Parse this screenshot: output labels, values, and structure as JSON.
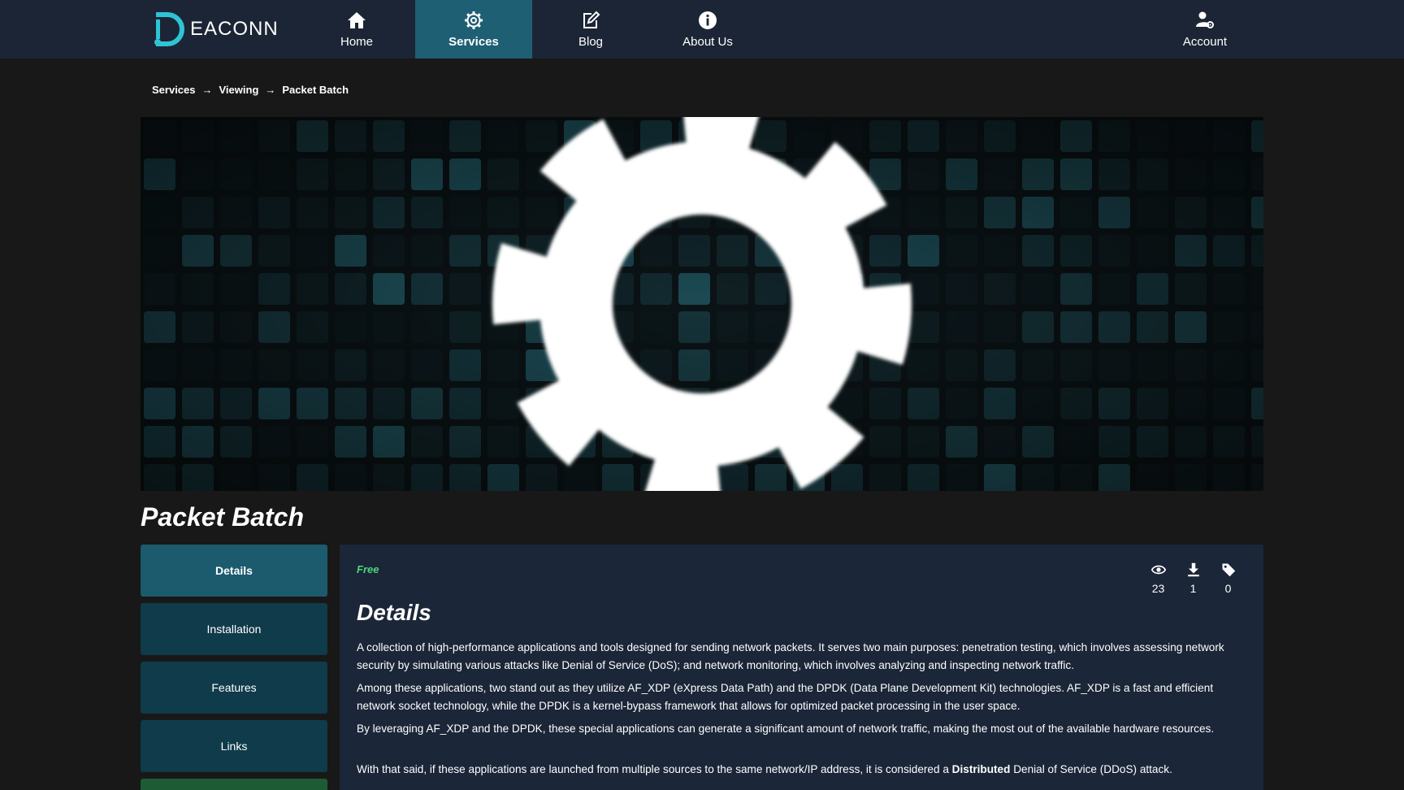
{
  "nav": {
    "logo_text": "EACONN",
    "items": [
      {
        "label": "Home",
        "icon": "home-icon"
      },
      {
        "label": "Services",
        "icon": "gear-icon"
      },
      {
        "label": "Blog",
        "icon": "edit-icon"
      },
      {
        "label": "About Us",
        "icon": "info-icon"
      },
      {
        "label": "Account",
        "icon": "user-gear-icon"
      }
    ],
    "active": "Services"
  },
  "breadcrumb": [
    "Services",
    "Viewing",
    "Packet Batch"
  ],
  "breadcrumb_separator": "→",
  "title": "Packet Batch",
  "sidebar": [
    "Details",
    "Installation",
    "Features",
    "Links"
  ],
  "panel": {
    "price": "Free",
    "stats": [
      {
        "icon": "eye-icon",
        "value": "23"
      },
      {
        "icon": "download-icon",
        "value": "1"
      },
      {
        "icon": "tag-icon",
        "value": "0"
      }
    ],
    "heading": "Details",
    "paragraphs": [
      "A collection of high-performance applications and tools designed for sending network packets. It serves two main purposes: penetration testing, which involves assessing network security by simulating various attacks like Denial of Service (DoS); and network monitoring, which involves analyzing and inspecting network traffic.",
      "Among these applications, two stand out as they utilize AF_XDP (eXpress Data Path) and the DPDK (Data Plane Development Kit) technologies. AF_XDP is a fast and efficient network socket technology, while the DPDK is a kernel-bypass framework that allows for optimized packet processing in the user space.",
      "By leveraging AF_XDP and the DPDK, these special applications can generate a significant amount of network traffic, making the most out of the available hardware resources."
    ],
    "para4": {
      "before": "With that said, if these applications are launched from multiple sources to the same network/IP address, it is considered a ",
      "bold": "Distributed",
      "after": " Denial of Service (DDoS) attack."
    }
  },
  "colors": {
    "nav_bg": "#1c2535",
    "nav_active": "#1f5f73",
    "page_bg": "#181818",
    "panel_bg": "#1b2638",
    "side_btn": "#0f3b4a",
    "side_btn_active": "#1c5a6d",
    "price_green": "#4dd67a",
    "logo_accent": "#2ec4d6"
  }
}
